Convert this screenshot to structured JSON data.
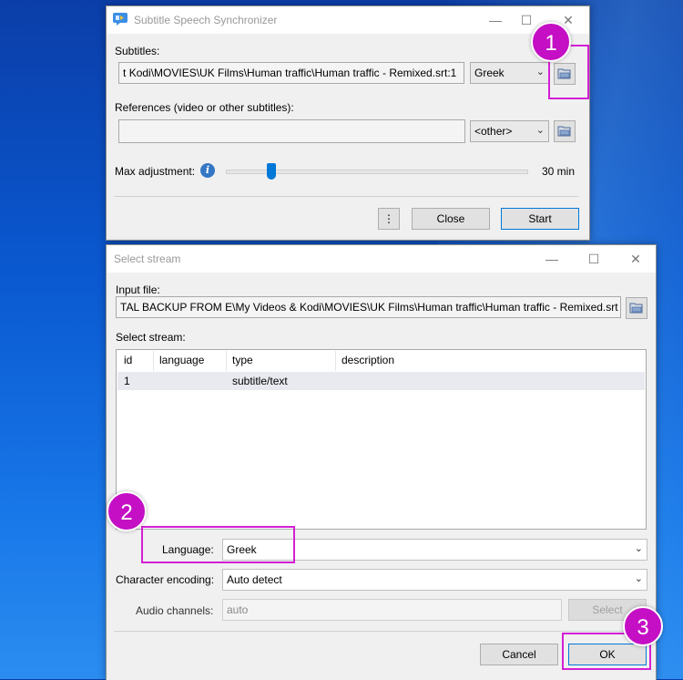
{
  "sync_window": {
    "title": "Subtitle Speech Synchronizer",
    "subtitles_label": "Subtitles:",
    "subtitles_path": "Kodi\\MOVIES\\UK Films\\Human traffic\\Human traffic - Remixed.srt:1",
    "subtitles_path_prefix": "t",
    "subtitles_language": "Greek",
    "references_label": "References (video or other subtitles):",
    "references_path": "",
    "references_language": "<other>",
    "max_adjustment_label": "Max adjustment:",
    "max_adjustment_value": "30 min",
    "slider_fraction": 0.15,
    "more_button": "⋮",
    "close_button": "Close",
    "start_button": "Start"
  },
  "stream_window": {
    "title": "Select stream",
    "input_file_label": "Input file:",
    "input_file_path": "TAL BACKUP FROM E\\My Videos & Kodi\\MOVIES\\UK Films\\Human traffic\\Human traffic - Remixed.srt",
    "select_stream_label": "Select stream:",
    "columns": [
      "id",
      "language",
      "type",
      "description"
    ],
    "rows": [
      {
        "id": "1",
        "language": "",
        "type": "subtitle/text",
        "description": ""
      }
    ],
    "language_label": "Language:",
    "language_value": "Greek",
    "encoding_label": "Character encoding:",
    "encoding_value": "Auto detect",
    "audio_channels_label": "Audio channels:",
    "audio_channels_value": "auto",
    "select_button": "Select",
    "cancel_button": "Cancel",
    "ok_button": "OK"
  },
  "annotations": {
    "badge1": "1",
    "badge2": "2",
    "badge3": "3",
    "highlight_color": "#d41fd4"
  }
}
